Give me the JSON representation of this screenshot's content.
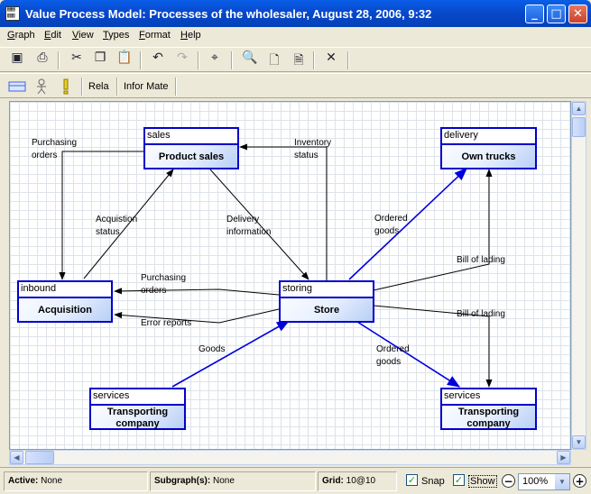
{
  "window": {
    "title": "Value Process Model: Processes of the wholesaler, August 28, 2006, 9:32",
    "app_icon": "diagram-app-icon",
    "minimize_icon": "minimize-icon",
    "maximize_icon": "maximize-icon",
    "close_icon": "close-icon"
  },
  "menu": [
    {
      "label": "Graph",
      "accel": "G"
    },
    {
      "label": "Edit",
      "accel": "E"
    },
    {
      "label": "View",
      "accel": "V"
    },
    {
      "label": "Types",
      "accel": "T"
    },
    {
      "label": "Format",
      "accel": "F"
    },
    {
      "label": "Help",
      "accel": "H"
    }
  ],
  "toolbar1": [
    {
      "icon": "new-graph-icon",
      "glyph": "▣"
    },
    {
      "icon": "print-icon",
      "glyph": "⎙"
    },
    {
      "icon": "cut-icon",
      "glyph": "✂"
    },
    {
      "icon": "copy-icon",
      "glyph": "❐"
    },
    {
      "icon": "paste-icon",
      "glyph": "📋"
    },
    {
      "icon": "undo-icon",
      "glyph": "↶"
    },
    {
      "icon": "redo-icon",
      "glyph": "↷"
    },
    {
      "icon": "layout-icon",
      "glyph": "⌖"
    },
    {
      "icon": "zoom-icon",
      "glyph": "🔍"
    },
    {
      "icon": "page-icon",
      "glyph": "🗋"
    },
    {
      "icon": "document-icon",
      "glyph": "🗎"
    },
    {
      "icon": "delete-icon",
      "glyph": "✕"
    }
  ],
  "toolbar2": {
    "process_icon": "process-node-icon",
    "actor_icon": "actor-icon",
    "note_icon": "info-marker-icon",
    "relation_label": "Rela",
    "info_label": "Infor Mate"
  },
  "diagram": {
    "nodes": [
      {
        "id": "sales",
        "type": "sales",
        "name": "Product sales"
      },
      {
        "id": "delivery",
        "type": "delivery",
        "name": "Own trucks"
      },
      {
        "id": "inbound",
        "type": "inbound",
        "name": "Acquisition"
      },
      {
        "id": "storing",
        "type": "storing",
        "name": "Store"
      },
      {
        "id": "services_left",
        "type": "services",
        "name": "Transporting company"
      },
      {
        "id": "services_right",
        "type": "services",
        "name": "Transporting company"
      }
    ],
    "edge_labels": {
      "purchasing_orders_top": "Purchasing orders",
      "inventory_status": "Inventory status",
      "acquisition_status": "Acquistion status",
      "delivery_information": "Delivery information",
      "ordered_goods_top": "Ordered goods",
      "bill_of_lading_top": "Bill of lading",
      "purchasing_orders_mid": "Purchasing orders",
      "error_reports": "Error reports",
      "goods": "Goods",
      "ordered_goods_bottom": "Ordered goods",
      "bill_of_lading_bottom": "Bill of lading"
    },
    "colors": {
      "node_border": "#0000cc",
      "flow_edge": "#0000dd",
      "info_edge": "#000000"
    }
  },
  "status": {
    "active_label": "Active:",
    "active_value": "None",
    "subgraph_label": "Subgraph(s):",
    "subgraph_value": "None",
    "grid_label": "Grid:",
    "grid_value": "10@10",
    "snap_label": "Snap",
    "snap_checked": true,
    "show_label": "Show",
    "show_checked": true,
    "zoom_value": "100%",
    "zoom_out_icon": "zoom-out-icon",
    "zoom_in_icon": "zoom-in-icon"
  }
}
